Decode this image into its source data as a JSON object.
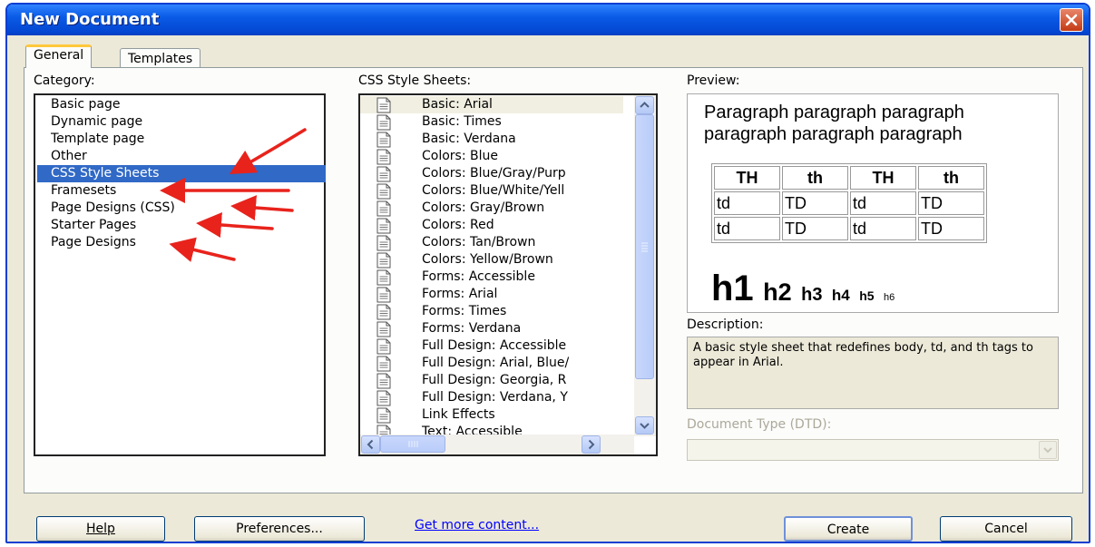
{
  "window": {
    "title": "New Document"
  },
  "tabs": [
    {
      "label": "General",
      "selected": true
    },
    {
      "label": "Templates",
      "selected": false
    }
  ],
  "category": {
    "label": "Category:",
    "items": [
      "Basic page",
      "Dynamic page",
      "Template page",
      "Other",
      "CSS Style Sheets",
      "Framesets",
      "Page Designs (CSS)",
      "Starter Pages",
      "Page Designs"
    ],
    "selected": "CSS Style Sheets"
  },
  "css_sheets": {
    "label": "CSS Style Sheets:",
    "items": [
      "Basic: Arial",
      "Basic: Times",
      "Basic: Verdana",
      "Colors: Blue",
      "Colors: Blue/Gray/Purp",
      "Colors: Blue/White/Yell",
      "Colors: Gray/Brown",
      "Colors: Red",
      "Colors: Tan/Brown",
      "Colors: Yellow/Brown",
      "Forms: Accessible",
      "Forms: Arial",
      "Forms: Times",
      "Forms: Verdana",
      "Full Design: Accessible",
      "Full Design: Arial, Blue/",
      "Full Design: Georgia, R",
      "Full Design: Verdana, Y",
      "Link Effects",
      "Text: Accessible"
    ],
    "selected": "Basic: Arial",
    "icon": "document-icon"
  },
  "preview": {
    "label": "Preview:",
    "paragraph_line1": "Paragraph paragraph paragraph",
    "paragraph_line2": "paragraph paragraph paragraph",
    "table": {
      "headers": [
        "TH",
        "th",
        "TH",
        "th"
      ],
      "rows": [
        [
          "td",
          "TD",
          "td",
          "TD"
        ],
        [
          "td",
          "TD",
          "td",
          "TD"
        ]
      ]
    },
    "headings": [
      "h1",
      "h2",
      "h3",
      "h4",
      "h5",
      "h6"
    ]
  },
  "description": {
    "label": "Description:",
    "text": "A basic style sheet that redefines body, td, and th tags to appear in Arial."
  },
  "doctype": {
    "label": "Document Type (DTD):",
    "value": ""
  },
  "buttons": {
    "help": "Help",
    "preferences": "Preferences...",
    "more_content": "Get more content...",
    "create": "Create",
    "cancel": "Cancel"
  },
  "colors": {
    "title_bar": "#0a5be6",
    "selection": "#3169c6",
    "annotation_arrow": "#e8231c",
    "link": "#0000ff"
  }
}
